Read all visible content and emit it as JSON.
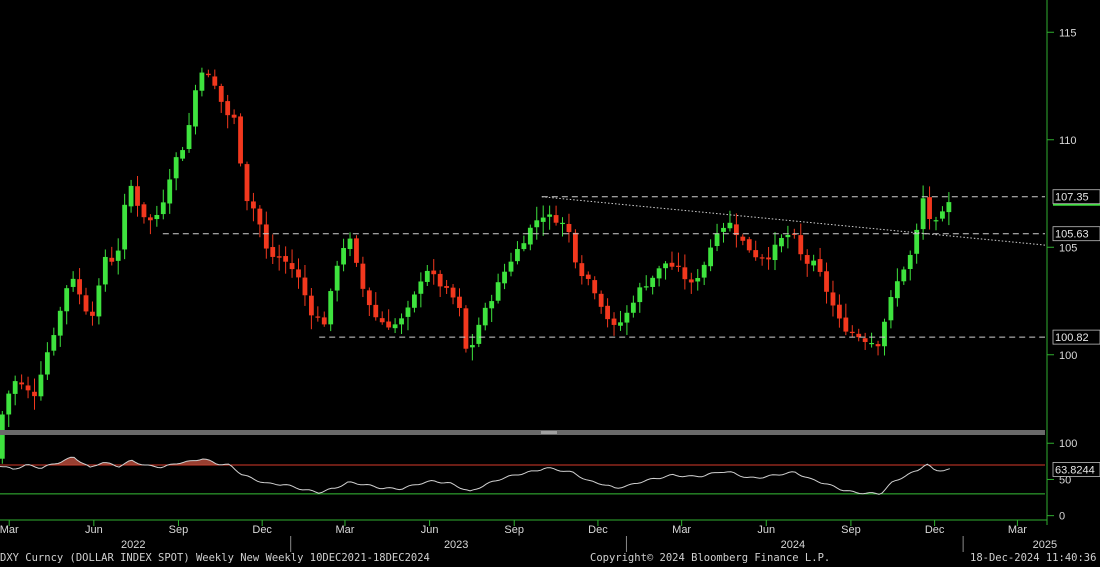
{
  "colors": {
    "background": "#000000",
    "up": "#3ee33e",
    "down": "#f2381e",
    "axis": "#2fae2f",
    "text": "#d8d8d8",
    "rsi_line": "#d0d0d0",
    "rsi_fill": "#b34a3a",
    "rsi_upper_line": "#d63a2a",
    "rsi_lower_line": "#36c036",
    "level_line": "#d0d0d0",
    "separator": "#6a6a6a"
  },
  "footer": {
    "left": "DXY Curncy (DOLLAR INDEX SPOT) Weekly New  Weekly 10DEC2021-18DEC2024",
    "center": "Copyright© 2024 Bloomberg Finance L.P.",
    "right": "18-Dec-2024 11:40:36"
  },
  "chart_data": {
    "type": "candlestick",
    "title": "",
    "price_axis": {
      "ylim": [
        96.5,
        116.5
      ],
      "ticks": [
        100,
        105,
        110,
        115
      ]
    },
    "rsi_axis": {
      "ylim": [
        -6,
        110
      ],
      "ticks": [
        0,
        50,
        100
      ]
    },
    "x_month_labels": [
      {
        "label": "Mar",
        "date": "2022-03-01"
      },
      {
        "label": "Jun",
        "date": "2022-06-01"
      },
      {
        "label": "Sep",
        "date": "2022-09-01"
      },
      {
        "label": "Dec",
        "date": "2022-12-01"
      },
      {
        "label": "Mar",
        "date": "2023-03-01"
      },
      {
        "label": "Jun",
        "date": "2023-06-01"
      },
      {
        "label": "Sep",
        "date": "2023-09-01"
      },
      {
        "label": "Dec",
        "date": "2023-12-01"
      },
      {
        "label": "Mar",
        "date": "2024-03-01"
      },
      {
        "label": "Jun",
        "date": "2024-06-01"
      },
      {
        "label": "Sep",
        "date": "2024-09-01"
      },
      {
        "label": "Dec",
        "date": "2024-12-01"
      },
      {
        "label": "Mar",
        "date": "2025-03-01"
      }
    ],
    "x_year_labels": [
      {
        "label": "2022",
        "date": "2022-07-15"
      },
      {
        "label": "2023",
        "date": "2023-07-01"
      },
      {
        "label": "2024",
        "date": "2024-07-01"
      },
      {
        "label": "2025",
        "date": "2025-04-01"
      }
    ],
    "x_range": [
      "2022-02-19",
      "2025-03-31"
    ],
    "price_path": [
      [
        "2022-02-19",
        96.4
      ],
      [
        "2022-02-28",
        97.8
      ],
      [
        "2022-03-08",
        98.8
      ],
      [
        "2022-03-20",
        98.5
      ],
      [
        "2022-03-30",
        98.0
      ],
      [
        "2022-04-10",
        99.6
      ],
      [
        "2022-04-25",
        101.5
      ],
      [
        "2022-05-10",
        103.9
      ],
      [
        "2022-05-24",
        102.2
      ],
      [
        "2022-06-05",
        101.9
      ],
      [
        "2022-06-15",
        104.6
      ],
      [
        "2022-06-28",
        104.3
      ],
      [
        "2022-07-12",
        108.1
      ],
      [
        "2022-07-25",
        106.6
      ],
      [
        "2022-08-05",
        106.2
      ],
      [
        "2022-08-15",
        106.7
      ],
      [
        "2022-08-29",
        108.9
      ],
      [
        "2022-09-12",
        109.9
      ],
      [
        "2022-09-27",
        113.4
      ],
      [
        "2022-10-12",
        112.6
      ],
      [
        "2022-10-26",
        111.2
      ],
      [
        "2022-11-05",
        110.9
      ],
      [
        "2022-11-15",
        107.4
      ],
      [
        "2022-11-28",
        106.6
      ],
      [
        "2022-12-10",
        104.6
      ],
      [
        "2022-12-25",
        104.5
      ],
      [
        "2023-01-10",
        103.8
      ],
      [
        "2023-01-28",
        101.8
      ],
      [
        "2023-02-10",
        101.5
      ],
      [
        "2023-02-25",
        104.6
      ],
      [
        "2023-03-08",
        105.5
      ],
      [
        "2023-03-22",
        103.2
      ],
      [
        "2023-04-05",
        101.8
      ],
      [
        "2023-04-18",
        101.4
      ],
      [
        "2023-05-01",
        101.4
      ],
      [
        "2023-05-15",
        102.3
      ],
      [
        "2023-05-30",
        104.1
      ],
      [
        "2023-06-12",
        103.4
      ],
      [
        "2023-06-28",
        102.7
      ],
      [
        "2023-07-05",
        102.4
      ],
      [
        "2023-07-15",
        99.8
      ],
      [
        "2023-07-28",
        101.5
      ],
      [
        "2023-08-12",
        102.8
      ],
      [
        "2023-08-28",
        104.2
      ],
      [
        "2023-09-12",
        105.2
      ],
      [
        "2023-09-26",
        106.2
      ],
      [
        "2023-10-05",
        106.5
      ],
      [
        "2023-10-20",
        106.3
      ],
      [
        "2023-11-01",
        105.9
      ],
      [
        "2023-11-12",
        104.0
      ],
      [
        "2023-11-26",
        103.4
      ],
      [
        "2023-12-08",
        102.3
      ],
      [
        "2023-12-20",
        101.2
      ],
      [
        "2024-01-02",
        101.7
      ],
      [
        "2024-01-15",
        102.9
      ],
      [
        "2024-02-01",
        103.6
      ],
      [
        "2024-02-16",
        104.3
      ],
      [
        "2024-03-01",
        103.9
      ],
      [
        "2024-03-15",
        103.2
      ],
      [
        "2024-03-28",
        104.2
      ],
      [
        "2024-04-12",
        105.9
      ],
      [
        "2024-04-26",
        106.1
      ],
      [
        "2024-05-10",
        105.2
      ],
      [
        "2024-05-24",
        104.6
      ],
      [
        "2024-06-07",
        104.6
      ],
      [
        "2024-06-21",
        105.4
      ],
      [
        "2024-07-02",
        105.7
      ],
      [
        "2024-07-14",
        104.3
      ],
      [
        "2024-07-28",
        104.2
      ],
      [
        "2024-08-10",
        102.8
      ],
      [
        "2024-08-24",
        101.4
      ],
      [
        "2024-09-06",
        101.0
      ],
      [
        "2024-09-20",
        100.7
      ],
      [
        "2024-10-03",
        100.5
      ],
      [
        "2024-10-15",
        102.3
      ],
      [
        "2024-10-28",
        103.8
      ],
      [
        "2024-11-10",
        104.8
      ],
      [
        "2024-11-22",
        107.4
      ],
      [
        "2024-12-01",
        105.9
      ],
      [
        "2024-12-10",
        106.3
      ],
      [
        "2024-12-18",
        107.0
      ]
    ],
    "annotations": {
      "current_price_label": "107.35",
      "levels": [
        {
          "value": 107.35,
          "label": "107.35",
          "start_date": "2023-10-01"
        },
        {
          "value": 105.63,
          "label": "105.63",
          "start_date": "2022-08-15"
        },
        {
          "value": 100.82,
          "label": "100.82",
          "start_date": "2023-02-01"
        }
      ],
      "trendline": [
        [
          "2023-10-01",
          107.35
        ],
        [
          "2025-03-31",
          105.1
        ]
      ]
    },
    "rsi": {
      "current_value": 63.8244,
      "current_label": "63.8244",
      "upper_line": 70,
      "lower_line": 30,
      "path": [
        [
          "2022-02-19",
          69
        ],
        [
          "2022-03-05",
          64
        ],
        [
          "2022-03-20",
          70
        ],
        [
          "2022-04-05",
          66
        ],
        [
          "2022-04-25",
          74
        ],
        [
          "2022-05-10",
          81
        ],
        [
          "2022-05-28",
          66
        ],
        [
          "2022-06-10",
          74
        ],
        [
          "2022-06-28",
          68
        ],
        [
          "2022-07-12",
          76
        ],
        [
          "2022-07-28",
          69
        ],
        [
          "2022-08-15",
          67
        ],
        [
          "2022-09-01",
          73
        ],
        [
          "2022-09-15",
          75
        ],
        [
          "2022-09-27",
          79
        ],
        [
          "2022-10-12",
          72
        ],
        [
          "2022-10-26",
          70
        ],
        [
          "2022-11-08",
          58
        ],
        [
          "2022-11-22",
          50
        ],
        [
          "2022-12-08",
          44
        ],
        [
          "2022-12-25",
          43
        ],
        [
          "2023-01-15",
          36
        ],
        [
          "2023-02-01",
          32
        ],
        [
          "2023-02-18",
          38
        ],
        [
          "2023-03-05",
          46
        ],
        [
          "2023-03-22",
          43
        ],
        [
          "2023-04-10",
          38
        ],
        [
          "2023-05-01",
          37
        ],
        [
          "2023-05-20",
          44
        ],
        [
          "2023-06-05",
          48
        ],
        [
          "2023-06-25",
          44
        ],
        [
          "2023-07-15",
          33
        ],
        [
          "2023-08-01",
          43
        ],
        [
          "2023-08-20",
          52
        ],
        [
          "2023-09-05",
          57
        ],
        [
          "2023-09-25",
          62
        ],
        [
          "2023-10-05",
          66
        ],
        [
          "2023-10-20",
          63
        ],
        [
          "2023-11-05",
          59
        ],
        [
          "2023-11-20",
          48
        ],
        [
          "2023-12-05",
          44
        ],
        [
          "2023-12-20",
          38
        ],
        [
          "2024-01-05",
          42
        ],
        [
          "2024-01-20",
          48
        ],
        [
          "2024-02-05",
          52
        ],
        [
          "2024-02-20",
          56
        ],
        [
          "2024-03-10",
          54
        ],
        [
          "2024-03-25",
          55
        ],
        [
          "2024-04-12",
          61
        ],
        [
          "2024-04-26",
          59
        ],
        [
          "2024-05-12",
          52
        ],
        [
          "2024-05-28",
          53
        ],
        [
          "2024-06-15",
          57
        ],
        [
          "2024-07-02",
          60
        ],
        [
          "2024-07-20",
          50
        ],
        [
          "2024-08-05",
          44
        ],
        [
          "2024-08-22",
          36
        ],
        [
          "2024-09-05",
          32
        ],
        [
          "2024-09-20",
          31
        ],
        [
          "2024-10-03",
          30
        ],
        [
          "2024-10-15",
          45
        ],
        [
          "2024-10-30",
          55
        ],
        [
          "2024-11-12",
          62
        ],
        [
          "2024-11-22",
          72
        ],
        [
          "2024-12-01",
          62
        ],
        [
          "2024-12-10",
          63
        ],
        [
          "2024-12-18",
          64
        ]
      ]
    },
    "legend": "none",
    "grid": false
  }
}
